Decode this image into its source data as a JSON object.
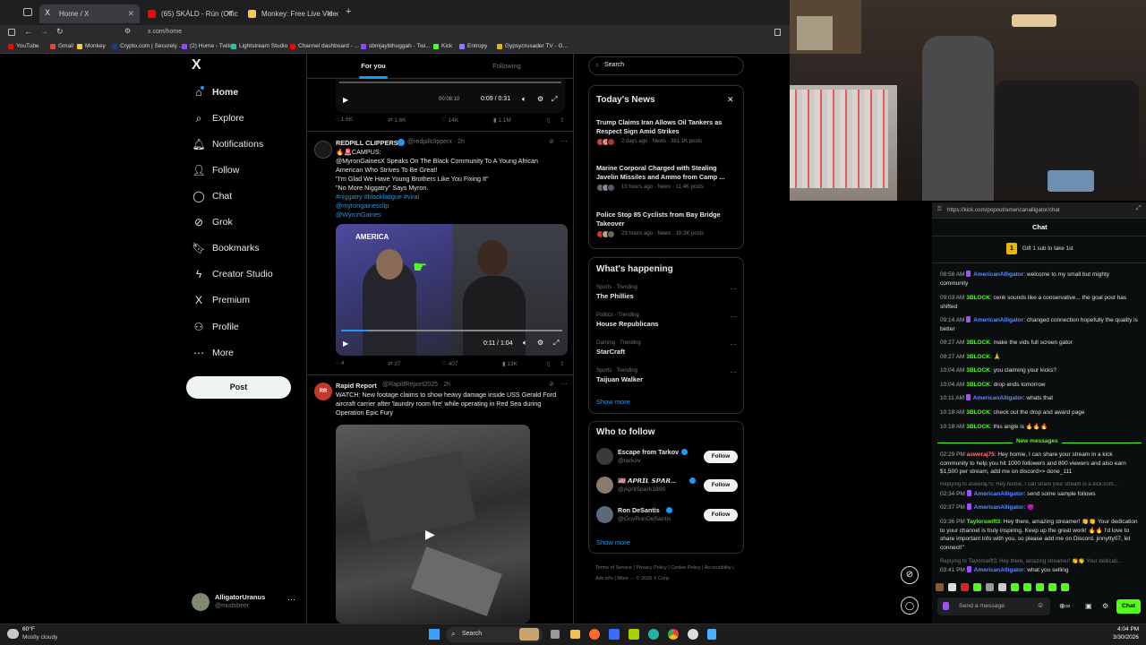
{
  "browser": {
    "tabs": [
      {
        "label": "Home / X",
        "color": "#e7e9ea"
      },
      {
        "label": "(65) SKÁLD - Rún (Official Music V",
        "color": "#ff0000"
      },
      {
        "label": "Monkey: Free Live Video Chat |",
        "color": "#f7c948"
      }
    ],
    "url": "x.com/home",
    "bookmarks": [
      {
        "label": "YouTube",
        "color": "#ff0000"
      },
      {
        "label": "Gmail",
        "color": "#ea4335"
      },
      {
        "label": "Monkey",
        "color": "#f7c948"
      },
      {
        "label": "Crypto.com | Securely ...",
        "color": "#1a3a8a"
      },
      {
        "label": "(2) Home - Twitch",
        "color": "#9146ff"
      },
      {
        "label": "Lightstream Studio",
        "color": "#25c2a0"
      },
      {
        "label": "Channel dashboard - ...",
        "color": "#ff0000"
      },
      {
        "label": "sbmjaybthuggah - Twi...",
        "color": "#9146ff"
      },
      {
        "label": "Kick",
        "color": "#53fc18"
      },
      {
        "label": "Entropy",
        "color": "#8a7cff"
      },
      {
        "label": "Gypsycrusader TV - G...",
        "color": "#e6b800"
      }
    ]
  },
  "x": {
    "logo": "X",
    "nav": [
      {
        "label": "Home",
        "icon": "home-icon",
        "glyph": "⌂"
      },
      {
        "label": "Explore",
        "icon": "search-icon",
        "glyph": "⌕"
      },
      {
        "label": "Notifications",
        "icon": "bell-icon",
        "glyph": "🔔︎"
      },
      {
        "label": "Follow",
        "icon": "person-add-icon",
        "glyph": "👤︎"
      },
      {
        "label": "Chat",
        "icon": "chat-icon",
        "glyph": "◯"
      },
      {
        "label": "Grok",
        "icon": "grok-icon",
        "glyph": "⊘"
      },
      {
        "label": "Bookmarks",
        "icon": "bookmark-icon",
        "glyph": "🔖︎"
      },
      {
        "label": "Creator Studio",
        "icon": "lightning-icon",
        "glyph": "ϟ"
      },
      {
        "label": "Premium",
        "icon": "x-premium-icon",
        "glyph": "X"
      },
      {
        "label": "Profile",
        "icon": "profile-icon",
        "glyph": "⚇"
      },
      {
        "label": "More",
        "icon": "more-circle-icon",
        "glyph": "⋯"
      }
    ],
    "post_button": "Post",
    "account": {
      "name": "AlligatorUranus",
      "handle": "@mudsbeer"
    },
    "feed_tabs": [
      "For you",
      "Following"
    ],
    "video1": {
      "time": "0:09 / 0:31",
      "scrub": "00:08:10"
    },
    "tweet1_actions": [
      "1.6K",
      "1.6K",
      "14K",
      "1.1M"
    ],
    "tweet2": {
      "author": "REDPILL CLIPPERS",
      "handle": "@redpillclipperx · 2h",
      "lines": [
        {
          "text": "🔥🚨CAMPUS:",
          "link": false
        },
        {
          "text": "@MyronGainesX Speaks On The Black Community To A Young African American Who Strives To Be Great!",
          "link": false
        },
        {
          "text": "\"I'm Glad We Have Young Brothers Like You Fixing It\"",
          "link": false
        },
        {
          "text": "\"No More Niggatry\" Says Myron.",
          "link": false
        },
        {
          "text": "#niggatry #blackfatigue #viral",
          "link": true
        },
        {
          "text": "@myrongainesclip",
          "link": true
        },
        {
          "text": "@WyronGaines",
          "link": true
        }
      ],
      "video_time": "0:11 / 1:04",
      "video_banner": "AMERICA",
      "actions": [
        "4",
        "37",
        "407",
        "13K"
      ]
    },
    "tweet3": {
      "author": "Rapid Report",
      "handle": "@RapidReport2025 · 2h",
      "text": "WATCH: New footage claims to show heavy damage inside USS Gerald Ford aircraft carrier after 'laundry room fire' while operating in Red Sea during Operation Epic Fury"
    },
    "search_placeholder": "Search",
    "todays_news": {
      "title": "Today's News",
      "items": [
        {
          "headline": "Trump Claims Iran Allows Oil Tankers as Respect Sign Amid Strikes",
          "meta": "2 days ago · News · 381.1K posts"
        },
        {
          "headline": "Marine Corporal Charged with Stealing Javelin Missiles and Ammo from Camp ...",
          "meta": "19 hours ago · News · 11.4K posts"
        },
        {
          "headline": "Police Stop 85 Cyclists from Bay Bridge Takeover",
          "meta": "23 hours ago · News · 10.3K posts"
        }
      ]
    },
    "whats_happening": {
      "title": "What's happening",
      "items": [
        {
          "meta": "Sports · Trending",
          "name": "The Phillies"
        },
        {
          "meta": "Politics · Trending",
          "name": "House Republicans"
        },
        {
          "meta": "Gaming · Trending",
          "name": "StarCraft"
        },
        {
          "meta": "Sports · Trending",
          "name": "Taijuan Walker"
        }
      ],
      "show_more": "Show more"
    },
    "who_to_follow": {
      "title": "Who to follow",
      "items": [
        {
          "name": "Escape from Tarkov",
          "handle": "@tarkov",
          "color": "#3a3a3a"
        },
        {
          "name": "🇺🇸 𝘼𝙋𝙍𝙄𝙇 𝙎𝙋𝘼𝙍...",
          "handle": "@AprilSpark1890",
          "color": "#8a7a6a"
        },
        {
          "name": "Ron DeSantis",
          "handle": "@GovRonDeSantis",
          "color": "#5a6a7a"
        }
      ],
      "follow_label": "Follow",
      "show_more": "Show more"
    },
    "footer": [
      "Terms of Service",
      "Privacy Policy",
      "Cookie Policy",
      "Accessibility",
      "Ads info",
      "More ···",
      "© 2026 X Corp."
    ]
  },
  "kick": {
    "url": "https://kick.com/popout/americanalligator/chat",
    "header": "Chat",
    "gift": "Gift 1 sub to take 1st",
    "messages": [
      {
        "time": "08:58 AM",
        "user": "AmericanAlligator",
        "cls": "u1",
        "text": ": welcome to my small but mighty community"
      },
      {
        "time": "09:03 AM",
        "user": "3BLOCK",
        "cls": "u2",
        "text": ": cenk sounds like a conservative... the goal post has shifted"
      },
      {
        "time": "09:14 AM",
        "user": "AmericanAlligator",
        "cls": "u1",
        "text": ": changed connection hopefully the quality is better"
      },
      {
        "time": "09:27 AM",
        "user": "3BLOCK",
        "cls": "u2",
        "text": ": make the vids full screen gator"
      },
      {
        "time": "09:27 AM",
        "user": "3BLOCK",
        "cls": "u2",
        "text": ": 🙏"
      },
      {
        "time": "10:04 AM",
        "user": "3BLOCK",
        "cls": "u2",
        "text": ": you claiming your kicks?"
      },
      {
        "time": "10:04 AM",
        "user": "3BLOCK",
        "cls": "u2",
        "text": ": drop ends tomorrow"
      },
      {
        "time": "10:11 AM",
        "user": "AmericanAlligator",
        "cls": "u1",
        "text": ": whats that"
      },
      {
        "time": "10:18 AM",
        "user": "3BLOCK",
        "cls": "u2",
        "text": ": check out the drop and award page"
      },
      {
        "time": "10:18 AM",
        "user": "3BLOCK",
        "cls": "u2",
        "text": ": this angle is 🔥🔥🔥"
      }
    ],
    "new_messages": "New messages",
    "messages2": [
      {
        "time": "02:29 PM",
        "user": "asweraj75",
        "cls": "u3",
        "text": ": Hey homie, I can share your stream in a kick community to help you hit 1000 followers and 800 viewers and also earn $1,500 per stream, add me on discord>> done_111"
      },
      {
        "time": "02:34 PM",
        "user": "AmericanAlligator",
        "cls": "u1",
        "text": ": send some sample follows"
      },
      {
        "time": "02:37 PM",
        "user": "AmericanAlligator",
        "cls": "u1",
        "text": ": 😈"
      },
      {
        "time": "03:36 PM",
        "user": "Taylorswift3",
        "cls": "u2",
        "text": ": Hey there, amazing streamer! 👏👏 Your dedication to your channel is truly inspiring. Keep up the great work! 🔥🔥 I'd love to share important info with you, so please add me on Discord. jinnytty07, let connect!\""
      },
      {
        "time": "03:41 PM",
        "user": "AmericanAlligator",
        "cls": "u1",
        "text": ": what you selling"
      }
    ],
    "reply1": "Replying to asweraj75: Hey homie, I can share your stream in a kick.com...",
    "reply2": "Replying to Taylorswift3: Hey there, amazing streamer! 👏👏 Your dedicati...",
    "input_placeholder": "Send a message",
    "chat_button": "Chat"
  },
  "taskbar": {
    "weather": "60°F",
    "weather_desc": "Mostly cloudy",
    "search": "Search",
    "time": "4:04 PM",
    "date": "3/30/2026"
  }
}
